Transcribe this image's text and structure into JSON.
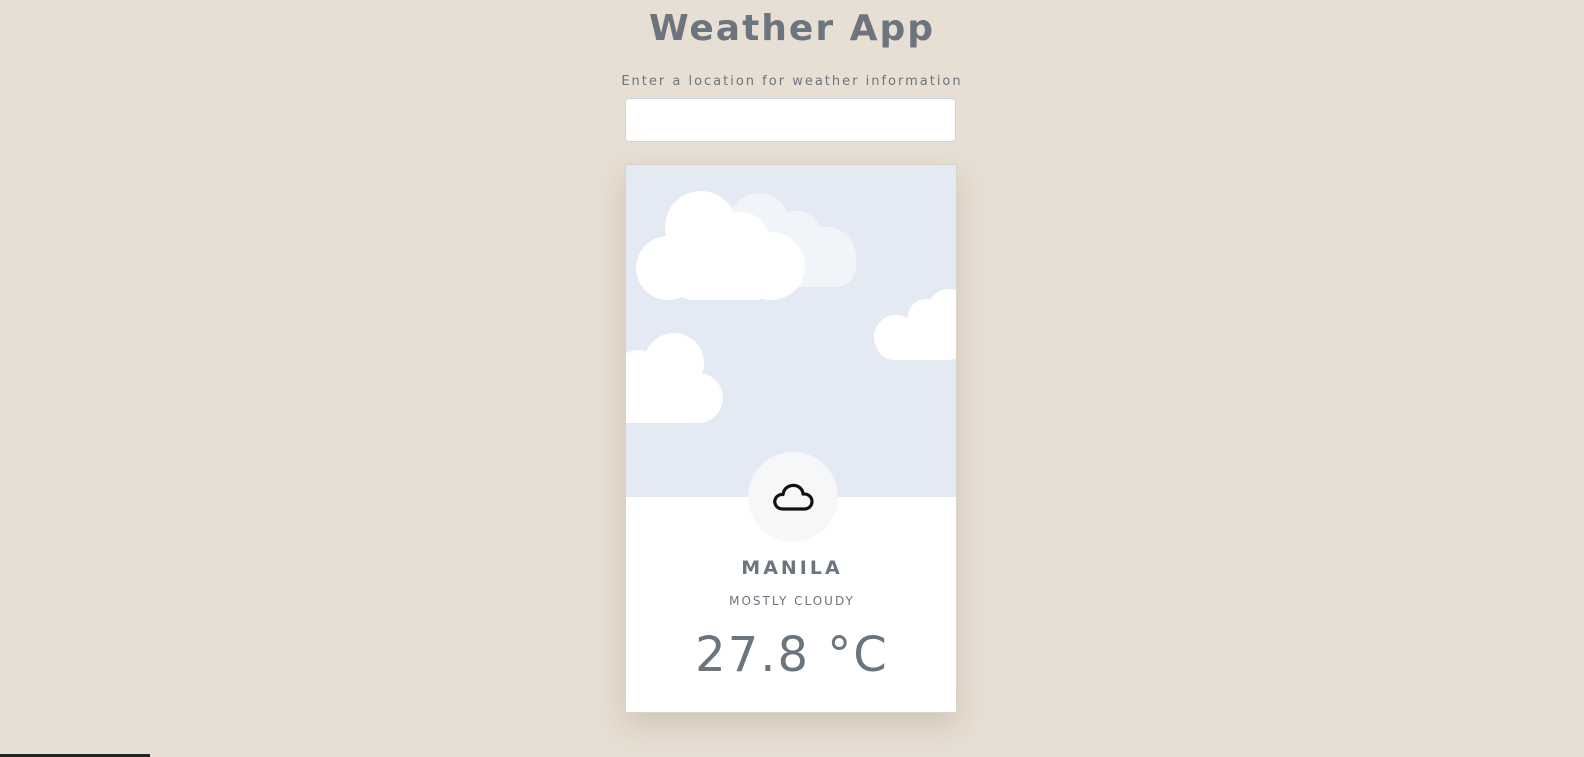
{
  "header": {
    "title": "Weather App"
  },
  "search": {
    "label": "Enter a location for weather information",
    "value": "",
    "placeholder": ""
  },
  "weather": {
    "city": "MANILA",
    "condition": "MOSTLY CLOUDY",
    "temperature": "27.8 °C",
    "icon": "cloud-icon"
  },
  "colors": {
    "background": "#e8dfd4",
    "sky": "#e4eaf4",
    "text": "#6c757d",
    "card": "#ffffff"
  }
}
